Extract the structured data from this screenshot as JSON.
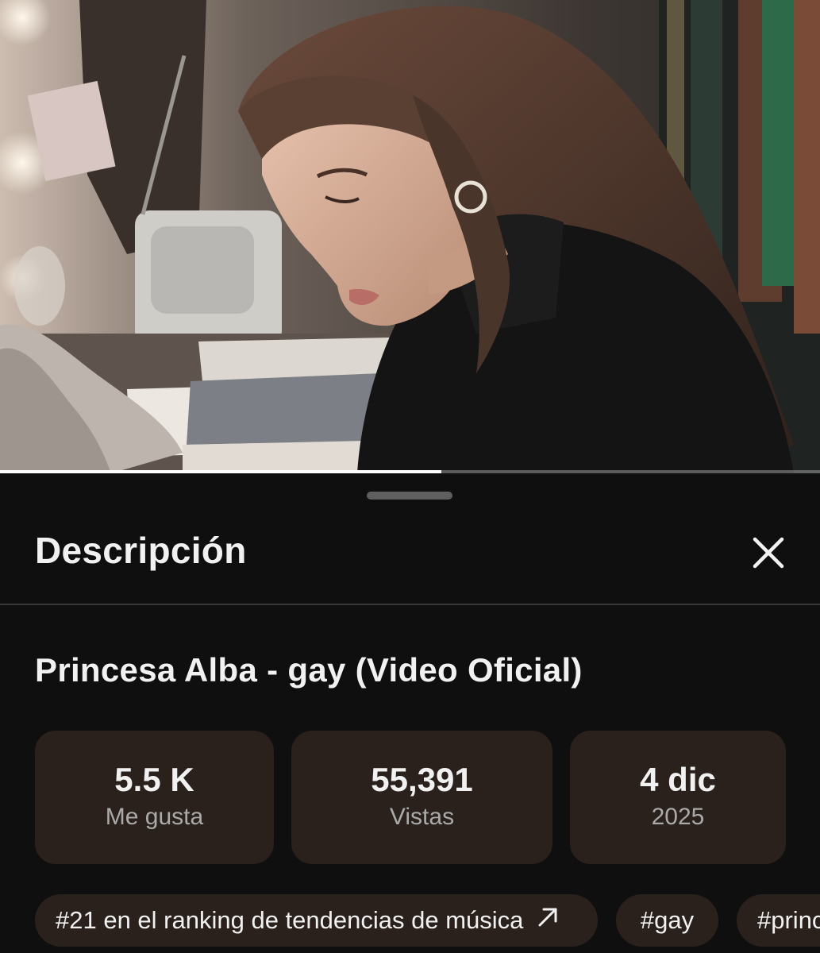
{
  "video": {
    "progress_fraction": 0.538
  },
  "sheet": {
    "title": "Descripción",
    "close_icon": "close-icon"
  },
  "video_title": "Princesa Alba - gay (Video Oficial)",
  "stats": {
    "likes_value": "5.5 K",
    "likes_label": "Me gusta",
    "views_value": "55,391",
    "views_label": "Vistas",
    "date_value": "4 dic",
    "date_label": "2025"
  },
  "chips": {
    "trend_label": "#21 en el ranking de tendencias de música",
    "trend_icon": "arrow-up-right-icon",
    "tag1": "#gay",
    "tag2": "#princ"
  },
  "colors": {
    "background": "#0f0f0f",
    "card": "#2a211d",
    "text_primary": "#f1f1f1",
    "text_secondary": "#aaaaaa"
  }
}
